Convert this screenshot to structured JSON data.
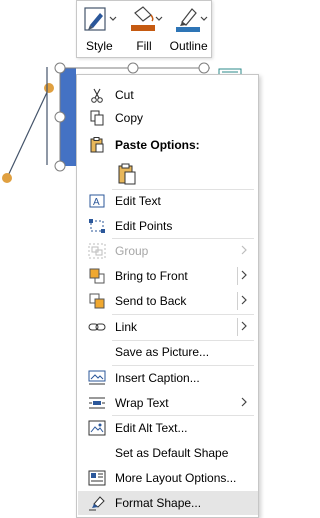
{
  "toolbar": {
    "style_label": "Style",
    "fill_label": "Fill",
    "outline_label": "Outline"
  },
  "colors": {
    "shape_fill": "#4472c4",
    "connector_handle": "#e0a040",
    "outline_swatch": "#2e75b6",
    "fill_swatch": "#c55a11",
    "accent_icon": "#2b579a"
  },
  "menu": {
    "cut": "Cut",
    "copy": "Copy",
    "paste_options": "Paste Options:",
    "edit_text": "Edit Text",
    "edit_points": "Edit Points",
    "group": "Group",
    "bring_to_front": "Bring to Front",
    "send_to_back": "Send to Back",
    "link": "Link",
    "save_as_picture": "Save as Picture...",
    "insert_caption": "Insert Caption...",
    "wrap_text": "Wrap Text",
    "edit_alt_text": "Edit Alt Text...",
    "set_default_shape": "Set as Default Shape",
    "more_layout_options": "More Layout Options...",
    "format_shape": "Format Shape..."
  }
}
